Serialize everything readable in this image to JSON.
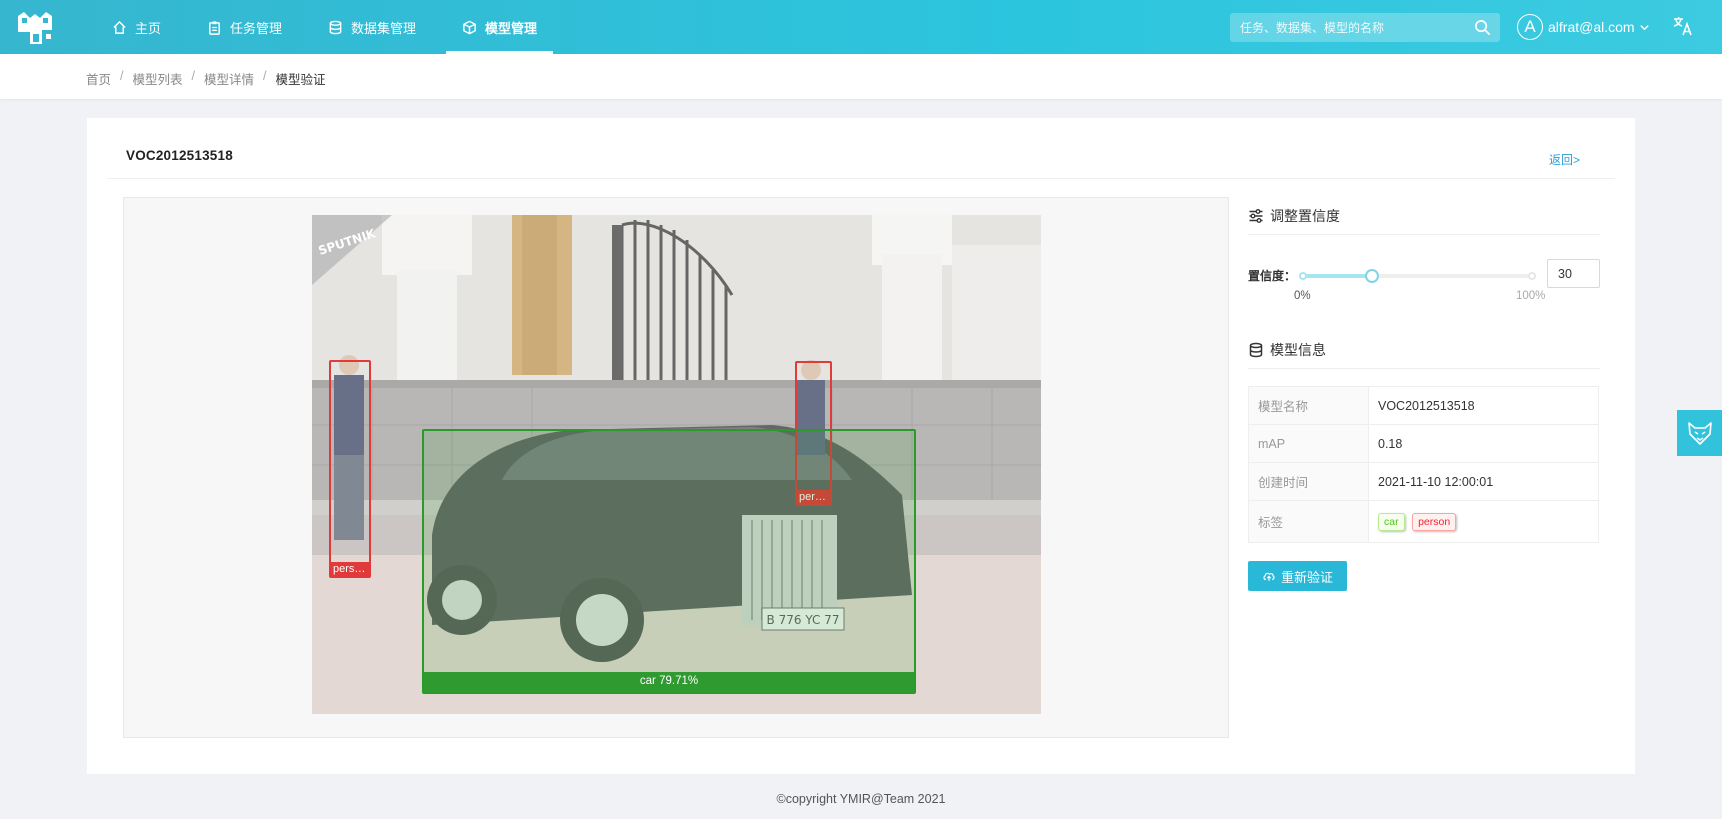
{
  "header": {
    "nav": [
      {
        "label": "主页",
        "icon": "home-icon"
      },
      {
        "label": "任务管理",
        "icon": "clipboard-icon"
      },
      {
        "label": "数据集管理",
        "icon": "database-icon"
      },
      {
        "label": "模型管理",
        "icon": "cube-icon",
        "active": true
      }
    ],
    "search_placeholder": "任务、数据集、模型的名称",
    "avatar_letter": "A",
    "user_email": "alfrat@al.com",
    "accent": "#2cc5de"
  },
  "breadcrumb": {
    "items": [
      "首页",
      "模型列表",
      "模型详情"
    ],
    "current": "模型验证"
  },
  "main": {
    "title": "VOC2012513518",
    "back_label": "返回>",
    "image": {
      "watermark": "SPUTNIK",
      "plate": "B 776 YC 77",
      "detections": [
        {
          "label": "perso...",
          "color": "#e03a3a"
        },
        {
          "label": "pers...",
          "color": "#e03a3a"
        },
        {
          "label": "car 79.71%",
          "color": "#2a9a2a"
        }
      ]
    }
  },
  "confidence": {
    "heading": "调整置信度",
    "label": "置信度：",
    "min_label": "0%",
    "max_label": "100%",
    "value": "30",
    "percent": 30
  },
  "model_info": {
    "heading": "模型信息",
    "rows": [
      {
        "key": "模型名称",
        "value": "VOC2012513518"
      },
      {
        "key": "mAP",
        "value": "0.18"
      },
      {
        "key": "创建时间",
        "value": "2021-11-10 12:00:01"
      }
    ],
    "tags_key": "标签",
    "tags": [
      "car",
      "person"
    ]
  },
  "actions": {
    "revalidate_label": "重新验证"
  },
  "footer": "©copyright YMIR@Team 2021"
}
